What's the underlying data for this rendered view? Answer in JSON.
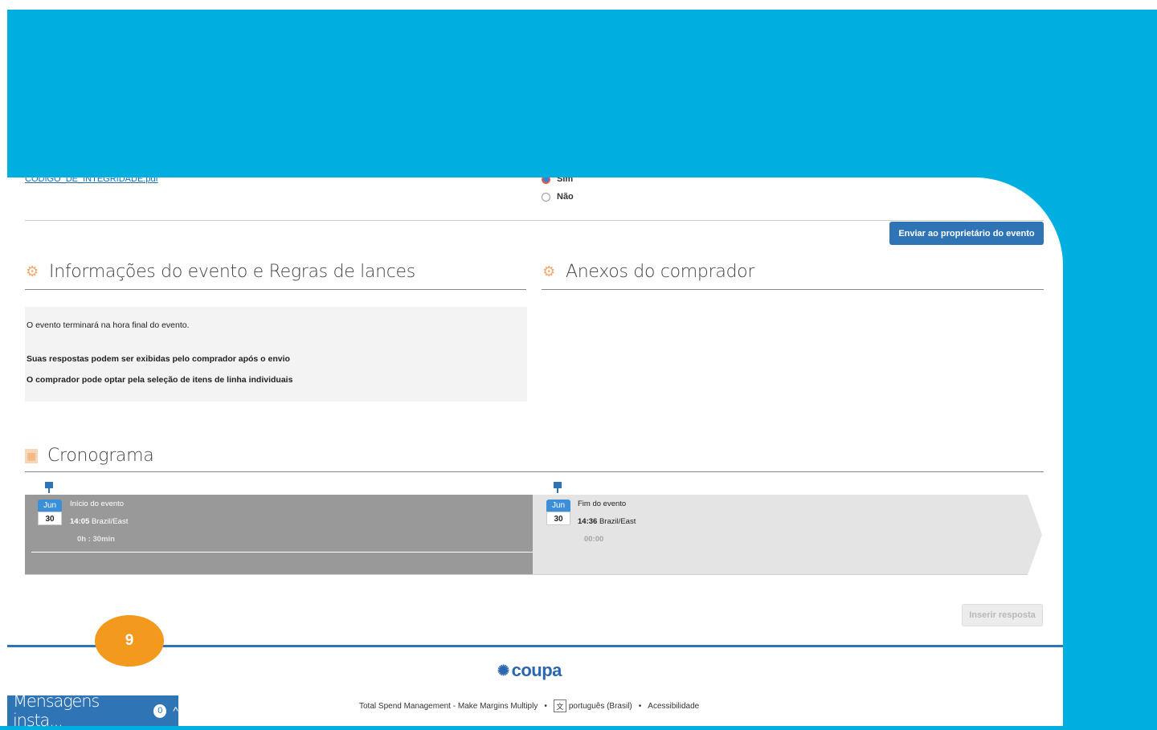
{
  "top_cut": {
    "attachment_link": "CODIGO_DE_INTEGRIDADE.pdf",
    "radio_yes": "Sim",
    "radio_no": "Não"
  },
  "send_button": "Enviar ao proprietário do evento",
  "event_info": {
    "title": "Informações do evento e Regras de lances",
    "line1": "O evento terminará na hora final do evento.",
    "line2": "Suas respostas podem ser exibidas pelo comprador após o envio",
    "line3": "O comprador pode optar pela seleção de itens de linha individuais"
  },
  "buyer_attachments": {
    "title": "Anexos do comprador"
  },
  "schedule": {
    "title": "Cronograma",
    "start": {
      "month": "Jun",
      "day": "30",
      "label": "Início do evento",
      "time": "14:05",
      "tz": "Brazil/East",
      "duration": "0h : 30min"
    },
    "end": {
      "month": "Jun",
      "day": "30",
      "label": "Fim do evento",
      "time": "14:36",
      "tz": "Brazil/East",
      "duration": "00:00"
    }
  },
  "submit_button": "Inserir resposta",
  "footer": {
    "logo": "coupa",
    "tagline": "Total Spend Management - Make Margins Multiply",
    "language": "português (Brasil)",
    "accessibility": "Acessibilidade"
  },
  "badge": "9",
  "chat": {
    "label": "Mensagens insta...",
    "count": "0"
  },
  "colors": {
    "background": "#00aedf",
    "primary": "#2f74b5",
    "badge": "#f39a1e"
  }
}
